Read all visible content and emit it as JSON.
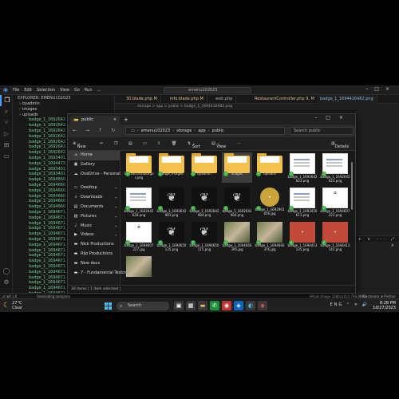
{
  "vscode": {
    "menu": [
      "File",
      "Edit",
      "Selection",
      "View",
      "Go",
      "Run",
      "..."
    ],
    "search": "emenu102023",
    "explorer": {
      "header": "EXPLORER: EMENU102023",
      "rows": [
        {
          "type": "folder",
          "name": "byadmin"
        },
        {
          "type": "folder",
          "name": "images"
        },
        {
          "type": "folder",
          "name": "uploads"
        },
        {
          "type": "file",
          "name": "badge_1_1692642..."
        },
        {
          "type": "file",
          "name": "badge_1_1692642..."
        },
        {
          "type": "file",
          "name": "badge_1_1692642..."
        },
        {
          "type": "file",
          "name": "badge_1_1692642..."
        },
        {
          "type": "file",
          "name": "badge_1_1692642..."
        },
        {
          "type": "file",
          "name": "badge_1_1692642..."
        },
        {
          "type": "file",
          "name": "badge_1_1692642..."
        },
        {
          "type": "file",
          "name": "badge_1_1693401..."
        },
        {
          "type": "file",
          "name": "badge_1_1694473..."
        },
        {
          "type": "file",
          "name": "badge_1_1693401..."
        },
        {
          "type": "file",
          "name": "badge_1_1693401..."
        },
        {
          "type": "file",
          "name": "badge_1_1694660..."
        },
        {
          "type": "file",
          "name": "badge_1_1694660..."
        },
        {
          "type": "file",
          "name": "badge_1_1694660..."
        },
        {
          "type": "file",
          "name": "badge_1_1694660..."
        },
        {
          "type": "file",
          "name": "badge_1_1694660..."
        },
        {
          "type": "file",
          "name": "badge_1_1694660..."
        },
        {
          "type": "file",
          "name": "badge_1_1694671..."
        },
        {
          "type": "file",
          "name": "badge_1_1694671..."
        },
        {
          "type": "file",
          "name": "badge_1_1694671..."
        },
        {
          "type": "file",
          "name": "badge_1_1694671..."
        },
        {
          "type": "file",
          "name": "badge_1_1694671..."
        },
        {
          "type": "file",
          "name": "badge_1_1694671..."
        },
        {
          "type": "file",
          "name": "badge_1_1694671..."
        },
        {
          "type": "file",
          "name": "badge_1_1694671..."
        },
        {
          "type": "file",
          "name": "badge_1_1694671..."
        },
        {
          "type": "file",
          "name": "badge_1_1694671..."
        },
        {
          "type": "file",
          "name": "badge_1_1694671..."
        },
        {
          "type": "file",
          "name": "badge_1_1694671..."
        },
        {
          "type": "file",
          "name": "badge_1_1694671..."
        },
        {
          "type": "file",
          "name": "badge_1_1694671..."
        },
        {
          "type": "file",
          "name": "badge_1_1694671..."
        },
        {
          "type": "file",
          "name": "badge_1_1694671..."
        }
      ]
    },
    "tabs": [
      {
        "label": "30.blade.php M",
        "state": "modified"
      },
      {
        "label": "info.blade.php M",
        "state": "modified"
      },
      {
        "label": "web.php",
        "state": "normal"
      },
      {
        "label": "RestaurantController.php 9, M",
        "state": "modified"
      },
      {
        "label": "badge_1_1694416482.png",
        "state": "active"
      }
    ],
    "breadcrumb": "storage > app > public > badge_1_1694416482.png",
    "panel_icons": "+ ∨ ··· ⤢ ×",
    "status_left": "⎇ ⊗0 ⚠0",
    "status_mid": "Generating complete",
    "status_right": "Cashmere  ⊞ Prettier",
    "status_img": "Whole Image   1080x1024   793.08KB"
  },
  "taskbar": {
    "weather_temp": "27°C",
    "weather_desc": "Clear",
    "search": "Search",
    "tray_icons": "ENG ⌃ ᯤ 🔊",
    "time": "8:28 PM",
    "date": "10/27/2023"
  },
  "file_explorer": {
    "tab_title": "public",
    "path": [
      "emenu102023",
      "storage",
      "app",
      "public"
    ],
    "search_placeholder": "Search public",
    "toolbar": {
      "new": "New",
      "sort": "Sort",
      "view": "View",
      "details": "Details"
    },
    "sidebar": [
      {
        "label": "Home",
        "icon": "⌂",
        "selected": true
      },
      {
        "label": "Gallery",
        "icon": "▣"
      },
      {
        "label": "OneDrive - Personal",
        "icon": "☁"
      },
      {
        "gap": true
      },
      {
        "label": "Desktop",
        "icon": "▭",
        "pinned": true
      },
      {
        "label": "Downloads",
        "icon": "⭳",
        "pinned": true
      },
      {
        "label": "Documents",
        "icon": "▤",
        "pinned": true
      },
      {
        "label": "Pictures",
        "icon": "▨",
        "pinned": true
      },
      {
        "label": "Music",
        "icon": "♪",
        "pinned": true
      },
      {
        "label": "Videos",
        "icon": "▶",
        "pinned": true
      },
      {
        "label": "Nick Productions",
        "icon": "▬"
      },
      {
        "label": "Rijo Productions",
        "icon": "▬"
      },
      {
        "label": "New docs",
        "icon": "▬"
      },
      {
        "label": "7 - Fundamental Testing...",
        "icon": "▬"
      }
    ],
    "items": [
      {
        "kind": "folder",
        "name": "1693401916burge r.png",
        "ok": true
      },
      {
        "kind": "folder",
        "name": "badge_images",
        "ok": true
      },
      {
        "kind": "folder",
        "name": "byadmin",
        "ok": true
      },
      {
        "kind": "folder",
        "name": "images",
        "ok": true,
        "selected": true
      },
      {
        "kind": "folder",
        "name": "uploads",
        "ok": true
      },
      {
        "kind": "doc",
        "name": "badge_1_1692642 623.png",
        "ok": true
      },
      {
        "kind": "doc",
        "name": "badge_1_1692642 623.png",
        "ok": true
      },
      {
        "kind": "doc",
        "name": "badge_1_1692642 628.png",
        "ok": true
      },
      {
        "kind": "paw",
        "name": "badge_1_1692642 981.png",
        "ok": true
      },
      {
        "kind": "paw",
        "name": "badge_1_1692642 984.png",
        "ok": true
      },
      {
        "kind": "paw",
        "name": "badge_1_1692642 984.png",
        "ok": true
      },
      {
        "kind": "gold",
        "name": "badge_1_1692901 656.jpg",
        "ok": true
      },
      {
        "kind": "doc",
        "name": "badge_1_1693416 611.png",
        "ok": true
      },
      {
        "kind": "badge",
        "name": "badge_1_1694607 223.png",
        "ok": true
      },
      {
        "kind": "badge",
        "name": "badge_1_1694607 227.jpg",
        "ok": true
      },
      {
        "kind": "paw",
        "name": "badge_1_1694650 135.png",
        "ok": true
      },
      {
        "kind": "paw",
        "name": "badge_1_1694650 175.png",
        "ok": true
      },
      {
        "kind": "photo",
        "name": "badge_1_1694660 395.jpg",
        "ok": true
      },
      {
        "kind": "photo",
        "name": "badge_1_1694660 376.jpg",
        "ok": true
      },
      {
        "kind": "gift",
        "name": "badge_1_1694413 135.png",
        "ok": true
      },
      {
        "kind": "gift",
        "name": "badge_1_1694413 142.png",
        "ok": true
      },
      {
        "kind": "photo",
        "name": "",
        "ok": false
      }
    ],
    "status": "30 items  |  1 item selected  |"
  },
  "colors": {
    "accent": "#3fa3ff",
    "folder": "#f2c14e",
    "ok_check": "#3cb043",
    "modified": "#e2c08d"
  }
}
